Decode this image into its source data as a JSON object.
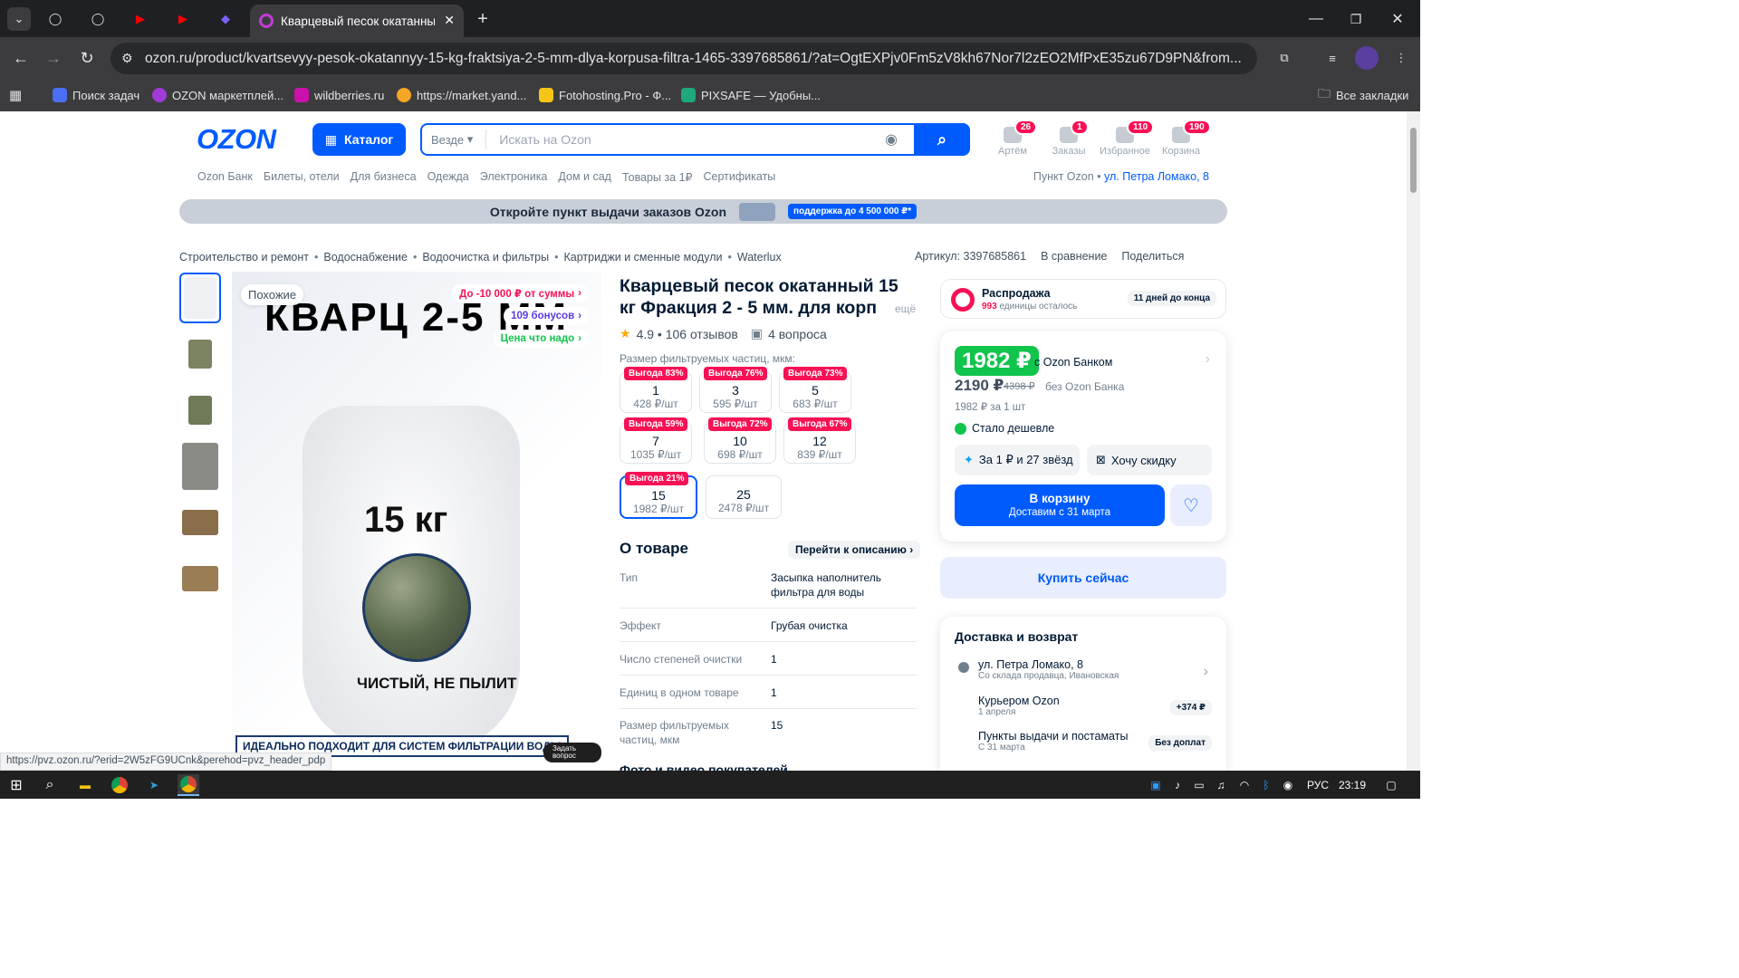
{
  "browser": {
    "active_tab_title": "Кварцевый песок окатанный",
    "url": "ozon.ru/product/kvartsevyy-pesok-okatannyy-15-kg-fraktsiya-2-5-mm-dlya-korpusa-filtra-1465-3397685861/?at=OgtEXPjv0Fm5zV8kh67Nor7l2zEO2MfPxE35zu67D9PN&from...",
    "bookmarks": [
      "Поиск задач",
      "OZON маркетплей...",
      "wildberries.ru",
      "https://market.yand...",
      "Fotohosting.Pro - Ф...",
      "PIXSAFE — Удобны..."
    ],
    "all_bookmarks": "Все закладки",
    "bookmark_colors": [
      "#4c6ef5",
      "#a03bd8",
      "#cb11ab",
      "#f5a623",
      "#f5c518",
      "#1ea97c"
    ]
  },
  "header": {
    "logo": "OZON",
    "catalog": "Каталог",
    "search_scope": "Везде",
    "search_placeholder": "Искать на Ozon",
    "icons": [
      {
        "label": "Артём",
        "badge": "26"
      },
      {
        "label": "Заказы",
        "badge": "1"
      },
      {
        "label": "Избранное",
        "badge": "110"
      },
      {
        "label": "Корзина",
        "badge": "190"
      }
    ],
    "subnav": [
      "Ozon Банк",
      "Билеты, отели",
      "Для бизнеса",
      "Одежда",
      "Электроника",
      "Дом и сад",
      "Товары за 1₽",
      "Сертификаты"
    ],
    "pickup_label": "Пункт Ozon •",
    "pickup_address": "ул. Петра Ломако, 8"
  },
  "banner": {
    "text": "Откройте пункт выдачи заказов Ozon",
    "pill": "поддержка до 4 500 000 ₽*"
  },
  "breadcrumbs": [
    "Строительство и ремонт",
    "Водоснабжение",
    "Водоочистка и фильтры",
    "Картриджи и сменные модули",
    "Waterlux"
  ],
  "actions": {
    "article": "Артикул: 3397685861",
    "compare": "В сравнение",
    "share": "Поделиться"
  },
  "gallery": {
    "similar": "Похожие",
    "promo_sum": "До -10 000 ₽ от суммы",
    "promo_bonus": "109 бонусов",
    "promo_price": "Цена что надо",
    "image_title": "КВАРЦ 2-5 ММ",
    "image_weight": "15 кг",
    "image_clean": "ЧИСТЫЙ, НЕ ПЫЛИТ",
    "image_fits": "ИДЕАЛЬНО ПОДХОДИТ ДЛЯ СИСТЕМ ФИЛЬТРАЦИИ ВОДЫ",
    "ask_question": "Задать вопрос"
  },
  "product": {
    "title": "Кварцевый песок окатанный 15 кг Фракция 2 - 5 мм. для корп",
    "more": "ещё",
    "rating": "4.9 • 106 отзывов",
    "questions": "4 вопроса",
    "size_label": "Размер фильтруемых частиц, мкм:",
    "sizes": [
      {
        "discount": "Выгода 83%",
        "value": "1",
        "price": "428 ₽/шт"
      },
      {
        "discount": "Выгода 76%",
        "value": "3",
        "price": "595 ₽/шт"
      },
      {
        "discount": "Выгода 73%",
        "value": "5",
        "price": "683 ₽/шт"
      },
      {
        "discount": "Выгода 59%",
        "value": "7",
        "price": "1035 ₽/шт"
      },
      {
        "discount": "Выгода 72%",
        "value": "10",
        "price": "698 ₽/шт"
      },
      {
        "discount": "Выгода 67%",
        "value": "12",
        "price": "839 ₽/шт"
      },
      {
        "discount": "Выгода 21%",
        "value": "15",
        "price": "1982 ₽/шт"
      },
      {
        "discount": "",
        "value": "25",
        "price": "2478 ₽/шт"
      }
    ],
    "about_heading": "О товаре",
    "goto_description": "Перейти к описанию",
    "specs": [
      {
        "key": "Тип",
        "value": "Засыпка наполнитель фильтра для воды"
      },
      {
        "key": "Эффект",
        "value": "Грубая очистка"
      },
      {
        "key": "Число степеней очистки",
        "value": "1"
      },
      {
        "key": "Единиц в одном товаре",
        "value": "1"
      },
      {
        "key": "Размер фильтруемых частиц, мкм",
        "value": "15"
      }
    ],
    "photos_heading": "Фото и видео покупателей"
  },
  "sale": {
    "title": "Распродажа",
    "count": "993",
    "count_suffix": "единицы осталось",
    "days_left": "11 дней до конца"
  },
  "price": {
    "ozon_price": "1982 ₽",
    "ozon_label": "с Ozon Банком",
    "regular_price": "2190 ₽",
    "old_price": "4398 ₽",
    "regular_label": "без Ozon Банка",
    "per_unit": "1982 ₽ за 1 шт",
    "cheaper": "Стало дешевле",
    "stars_offer": "За 1 ₽ и 27 звёзд",
    "want_discount": "Хочу скидку",
    "cart_button": "В корзину",
    "cart_sub": "Доставим с 31 марта",
    "buy_now": "Купить сейчас"
  },
  "delivery": {
    "heading": "Доставка и возврат",
    "address": "ул. Петра Ломако, 8",
    "address_sub": "Со склада продавца, Ивановская",
    "courier": "Курьером Ozon",
    "courier_date": "1 апреля",
    "courier_price": "+374 ₽",
    "points": "Пункты выдачи и постаматы",
    "points_date": "С 31 марта",
    "points_price": "Без доплат"
  },
  "status_link": "https://pvz.ozon.ru/?erid=2W5zFG9UCnk&perehod=pvz_header_pdp",
  "taskbar": {
    "lang": "РУС",
    "time": "23:19"
  }
}
